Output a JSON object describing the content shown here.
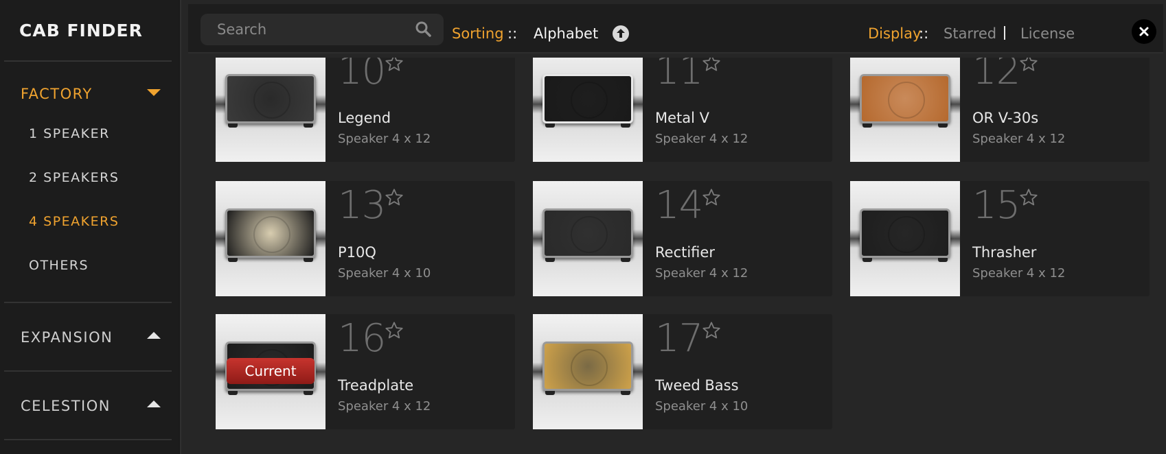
{
  "sidebar": {
    "title": "CAB FINDER",
    "sections": [
      {
        "label": "FACTORY",
        "expanded": true
      },
      {
        "label": "EXPANSION",
        "expanded": false
      },
      {
        "label": "CELESTION",
        "expanded": false
      }
    ],
    "factory_items": [
      "1 SPEAKER",
      "2 SPEAKERS",
      "4 SPEAKERS",
      "OTHERS"
    ],
    "selected_item": "4 SPEAKERS"
  },
  "topbar": {
    "search_placeholder": "Search",
    "sorting_label": "Sorting",
    "sep": "::",
    "sorting_value": "Alphabet",
    "display_label": "Display",
    "display_starred": "Starred",
    "display_license": "License"
  },
  "cabs": [
    {
      "num": "10",
      "name": "Legend",
      "spec": "Speaker 4 x 12",
      "color": "#3b3b3b",
      "grille": "#2a2a2a"
    },
    {
      "num": "11",
      "name": "Metal V",
      "spec": "Speaker 4 x 12",
      "color": "#1a1a1a",
      "grille": "#1e1e1e"
    },
    {
      "num": "12",
      "name": "OR V-30s",
      "spec": "Speaker 4 x 12",
      "color": "#b5692e",
      "grille": "#c98a5a"
    },
    {
      "num": "13",
      "name": "P10Q",
      "spec": "Speaker 4 x 10",
      "color": "#1c1c1c",
      "grille": "#d8cdb0"
    },
    {
      "num": "14",
      "name": "Rectifier",
      "spec": "Speaker 4 x 12",
      "color": "#2a2a2a",
      "grille": "#303030"
    },
    {
      "num": "15",
      "name": "Thrasher",
      "spec": "Speaker 4 x 12",
      "color": "#1e1e1e",
      "grille": "#262626"
    },
    {
      "num": "16",
      "name": "Treadplate",
      "spec": "Speaker 4 x 12",
      "color": "#1c1c1c",
      "grille": "#2a2a2a",
      "current": true
    },
    {
      "num": "17",
      "name": "Tweed Bass",
      "spec": "Speaker 4 x 10",
      "color": "#cfa24a",
      "grille": "#7a6a45"
    }
  ],
  "current_label": "Current",
  "colors": {
    "accent": "#f0a32f",
    "background": "#262626",
    "card": "#202020"
  }
}
